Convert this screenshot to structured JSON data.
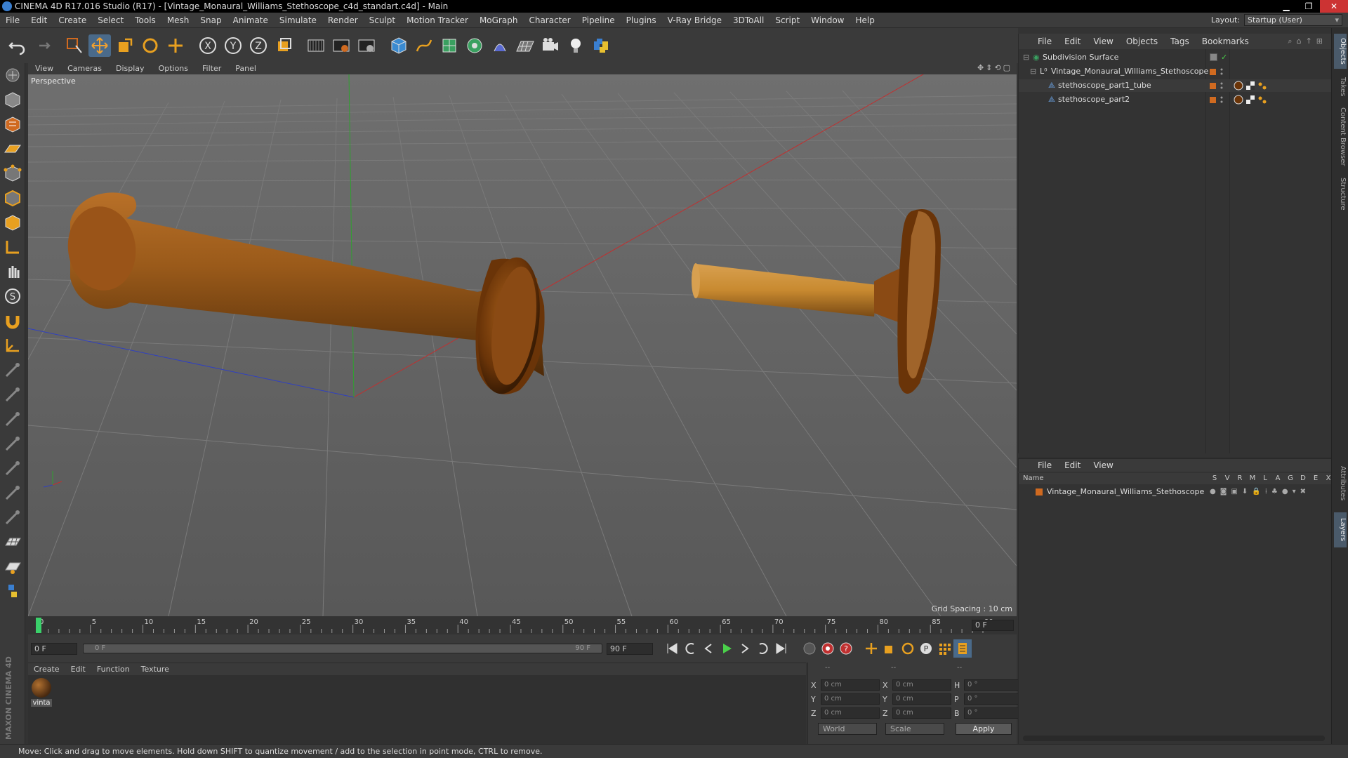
{
  "window": {
    "title": "CINEMA 4D R17.016 Studio (R17) - [Vintage_Monaural_Williams_Stethoscope_c4d_standart.c4d] - Main"
  },
  "menu": {
    "items": [
      "File",
      "Edit",
      "Create",
      "Select",
      "Tools",
      "Mesh",
      "Snap",
      "Animate",
      "Simulate",
      "Render",
      "Sculpt",
      "Motion Tracker",
      "MoGraph",
      "Character",
      "Pipeline",
      "Plugins",
      "V-Ray Bridge",
      "3DToAll",
      "Script",
      "Window",
      "Help"
    ],
    "layout_label": "Layout:",
    "layout_value": "Startup (User)"
  },
  "viewport": {
    "menu": [
      "View",
      "Cameras",
      "Display",
      "Options",
      "Filter",
      "Panel"
    ],
    "camera_label": "Perspective",
    "grid_spacing": "Grid Spacing : 10 cm"
  },
  "timeline": {
    "ticks": [
      "0",
      "5",
      "10",
      "15",
      "20",
      "25",
      "30",
      "35",
      "40",
      "45",
      "50",
      "55",
      "60",
      "65",
      "70",
      "75",
      "80",
      "85",
      "90"
    ],
    "current_frame": "0 F"
  },
  "transport": {
    "start_frame": "0 F",
    "range_start": "0 F",
    "range_end": "90 F",
    "end_frame": "90 F"
  },
  "materials": {
    "menu": [
      "Create",
      "Edit",
      "Function",
      "Texture"
    ],
    "items": [
      {
        "label": "vinta"
      }
    ]
  },
  "coords": {
    "headers": [
      "--",
      "--",
      "--"
    ],
    "rows": [
      {
        "a1": "X",
        "v1": "0 cm",
        "a2": "X",
        "v2": "0 cm",
        "a3": "H",
        "v3": "0 °"
      },
      {
        "a1": "Y",
        "v1": "0 cm",
        "a2": "Y",
        "v2": "0 cm",
        "a3": "P",
        "v3": "0 °"
      },
      {
        "a1": "Z",
        "v1": "0 cm",
        "a2": "Z",
        "v2": "0 cm",
        "a3": "B",
        "v3": "0 °"
      }
    ],
    "space": "World",
    "mode": "Scale",
    "apply_label": "Apply"
  },
  "status": {
    "text": "Move: Click and drag to move elements. Hold down SHIFT to quantize movement / add to the selection in point mode, CTRL to remove."
  },
  "objects": {
    "menu": [
      "File",
      "Edit",
      "View",
      "Objects",
      "Tags",
      "Bookmarks"
    ],
    "tree": [
      {
        "name": "Subdivision Surface"
      },
      {
        "name": "Vintage_Monaural_Williams_Stethoscope"
      },
      {
        "name": "stethoscope_part1_tube"
      },
      {
        "name": "stethoscope_part2"
      }
    ]
  },
  "layers": {
    "menu": [
      "File",
      "Edit",
      "View"
    ],
    "name_header": "Name",
    "columns": [
      "S",
      "V",
      "R",
      "M",
      "L",
      "A",
      "G",
      "D",
      "E",
      "X"
    ],
    "items": [
      {
        "name": "Vintage_Monaural_Williams_Stethoscope"
      }
    ]
  },
  "right_tabs": [
    "Objects",
    "Takes",
    "Content Browser",
    "Structure",
    "Attributes",
    "Layers"
  ],
  "colors": {
    "accent": "#d06a20",
    "x_axis": "#c03030",
    "y_axis": "#30a030",
    "z_axis": "#3040c0",
    "selection_blue": "#3a7fd0"
  }
}
